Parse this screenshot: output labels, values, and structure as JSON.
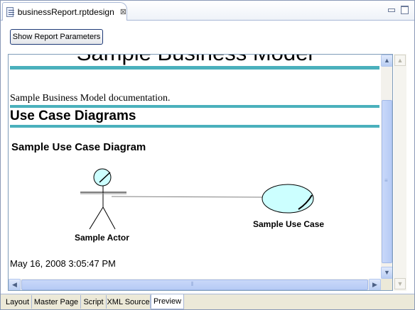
{
  "editor": {
    "tab_title": "businessReport.rptdesign",
    "close_glyph": "⊠"
  },
  "toolbar": {
    "show_params_label": "Show Report Parameters"
  },
  "report": {
    "title": "Sample Business Model",
    "documentation": "Sample Business Model documentation.",
    "section_heading": "Use Case Diagrams",
    "diagram_heading": "Sample Use Case Diagram",
    "actor_label": "Sample Actor",
    "usecase_label": "Sample Use Case",
    "timestamp": "May 16, 2008 3:05:47 PM",
    "band_color": "#4ab0bc",
    "usecase_fill": "#ccffff"
  },
  "bottom_tabs": [
    {
      "label": "Layout",
      "active": false
    },
    {
      "label": "Master Page",
      "active": false
    },
    {
      "label": "Script",
      "active": false
    },
    {
      "label": "XML Source",
      "active": false
    },
    {
      "label": "Preview",
      "active": true
    }
  ],
  "icons": {
    "scroll_up": "▲",
    "scroll_down": "▼",
    "scroll_left": "◀",
    "scroll_right": "▶"
  }
}
